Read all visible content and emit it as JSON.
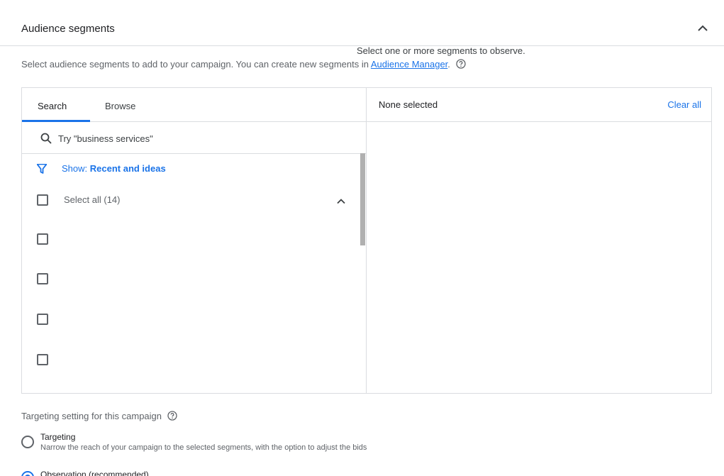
{
  "section": {
    "title": "Audience segments",
    "description_prefix": "Select audience segments to add to your campaign. You can create new segments in ",
    "description_link": "Audience Manager",
    "description_suffix": "."
  },
  "tabs": [
    {
      "label": "Search",
      "active": true
    },
    {
      "label": "Browse",
      "active": false
    }
  ],
  "search": {
    "placeholder": "Try \"business services\"",
    "value": ""
  },
  "filter": {
    "prefix": "Show: ",
    "value": "Recent and ideas"
  },
  "list": {
    "select_all_label": "Select all (14)",
    "visible_unlabeled_items": 4
  },
  "selection": {
    "status": "None selected",
    "clear_label": "Clear all",
    "empty_message": "Select one or more segments to observe."
  },
  "targeting_setting": {
    "label": "Targeting setting for this campaign",
    "options": [
      {
        "title": "Targeting",
        "description": "Narrow the reach of your campaign to the selected segments, with the option to adjust the bids",
        "selected": false
      },
      {
        "title": "Observation (recommended)",
        "selected": true
      }
    ]
  },
  "colors": {
    "accent": "#1a73e8",
    "border": "#dadce0",
    "text": "#3c4043"
  },
  "icons": [
    "chevron-up-icon",
    "help-icon",
    "search-icon",
    "filter-icon"
  ]
}
